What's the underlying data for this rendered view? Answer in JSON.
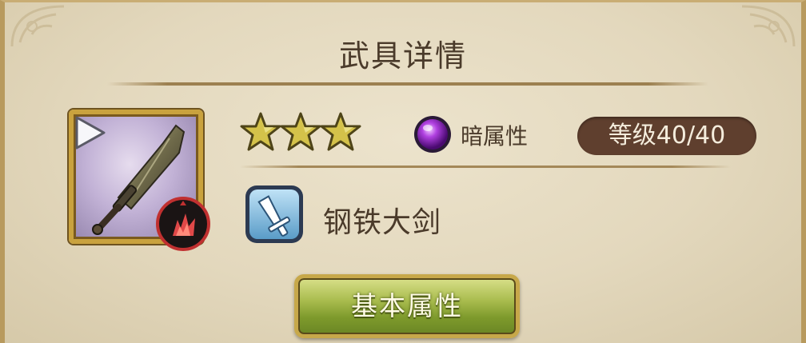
{
  "header": {
    "title": "武具详情"
  },
  "weapon": {
    "rarity_stars": 3,
    "element_label": "暗属性",
    "level_label": "等级",
    "level_value": "40/40",
    "name": "钢铁大剑",
    "icon": "greatsword-icon",
    "type_icon": "sword-type-icon",
    "element_icon": "dark-element-orb-icon",
    "attack_type_icon": "burst-attack-icon"
  },
  "actions": {
    "basic_attributes_label": "基本属性"
  },
  "colors": {
    "panel_bg": "#e3d8bd",
    "text": "#4a3a2a",
    "level_pill": "#5f3f2e",
    "button_green": "#8faa38",
    "frame_gold": "#c9a23e",
    "dark_orb": "#9a2fc0"
  }
}
